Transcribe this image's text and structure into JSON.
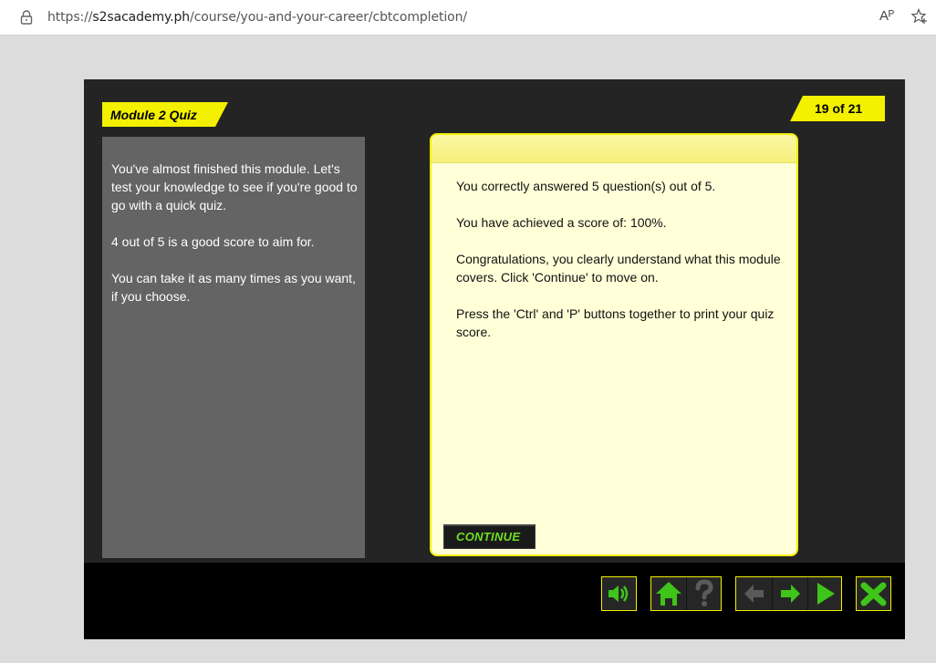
{
  "browser": {
    "url_prefix": "https://",
    "url_host": "s2sacademy.ph",
    "url_path": "/course/you-and-your-career/cbtcompletion/",
    "read_aloud_label": "Aᴾ"
  },
  "header": {
    "module_title": "Module 2 Quiz",
    "page_counter": "19 of 21"
  },
  "intro": {
    "paragraphs": [
      "You've almost finished this module. Let's test your knowledge to see if you're good to go with a quick quiz.",
      "4 out of 5 is a good score to aim for.",
      "You can take it as many times as you want, if you choose."
    ]
  },
  "result": {
    "lines": [
      "You correctly answered 5 question(s) out of 5.",
      "You have achieved a score of: 100%.",
      "Congratulations, you clearly understand what this module covers. Click 'Continue' to move on.",
      "Press the 'Ctrl' and 'P' buttons together to print your quiz score."
    ],
    "continue_label": "CONTINUE"
  },
  "nav_icons": [
    "sound-icon",
    "home-icon",
    "help-icon",
    "back-arrow-icon",
    "forward-arrow-icon",
    "play-icon",
    "close-icon"
  ],
  "colors": {
    "accent_yellow": "#f3f000",
    "button_green": "#3fc41a",
    "continue_text": "#6ee01f"
  }
}
